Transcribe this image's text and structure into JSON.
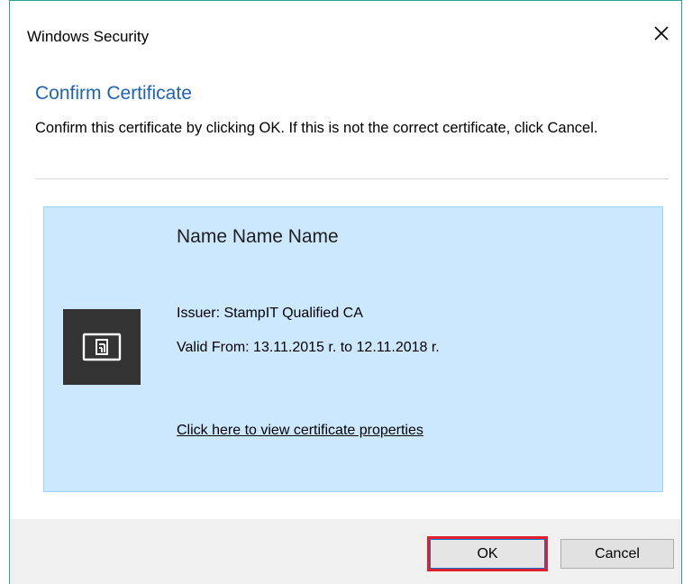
{
  "window": {
    "title": "Windows Security"
  },
  "dialog": {
    "heading": "Confirm Certificate",
    "description": "Confirm this certificate by clicking OK. If this is not the correct certificate, click Cancel."
  },
  "certificate": {
    "name": "Name Name Name",
    "issuer": "Issuer: StampIT Qualified CA",
    "valid": "Valid From: 13.11.2015 r. to 12.11.2018 r.",
    "link": "Click here to view certificate properties",
    "icon": "certificate-card-icon"
  },
  "buttons": {
    "ok_label": "OK",
    "cancel_label": "Cancel"
  },
  "colors": {
    "accent": "#1e63b8",
    "selection_bg": "#cce8ff",
    "highlight": "#e0202e"
  }
}
